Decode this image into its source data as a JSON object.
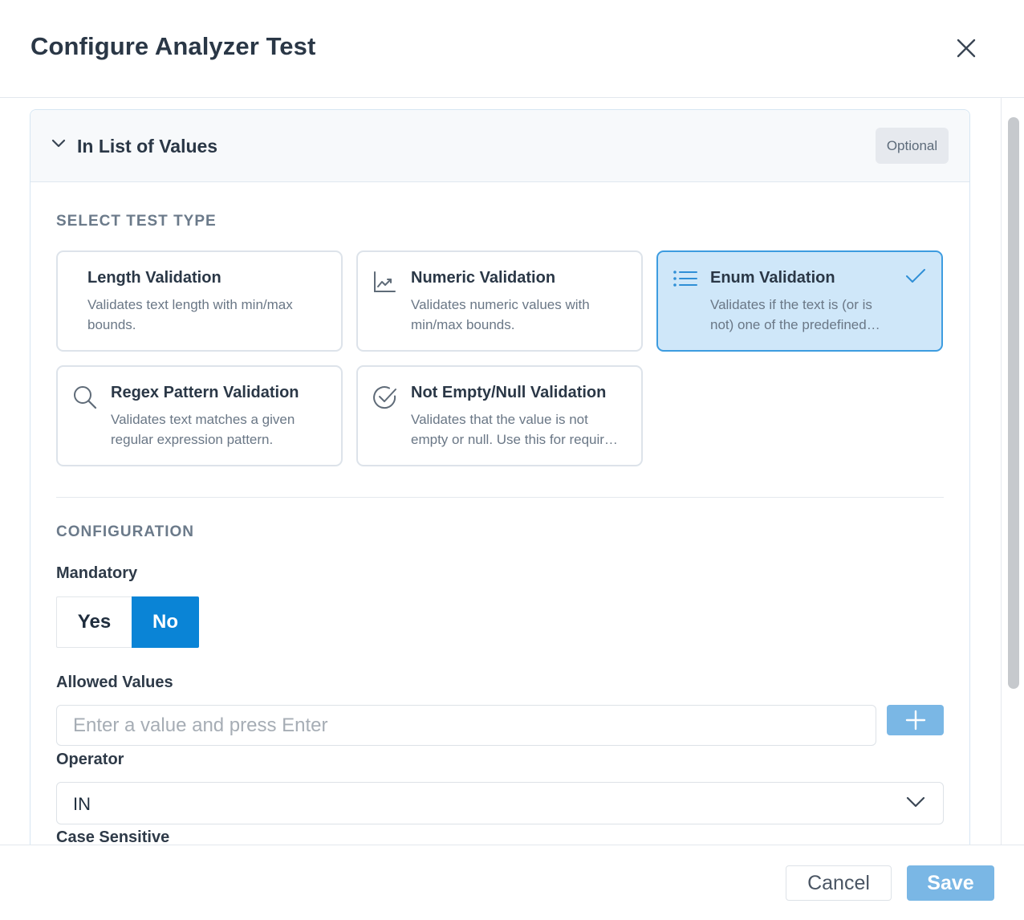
{
  "dialog": {
    "title": "Configure Analyzer Test"
  },
  "section": {
    "title": "In List of Values",
    "badge": "Optional",
    "expanded": true
  },
  "test_type": {
    "heading": "SELECT TEST TYPE",
    "cards": [
      {
        "title": "Length Validation",
        "description": "Validates text length with min/max bounds.",
        "icon": "none",
        "selected": false
      },
      {
        "title": "Numeric Validation",
        "description": "Validates numeric values with min/max bounds.",
        "icon": "chart-line-icon",
        "selected": false
      },
      {
        "title": "Enum Validation",
        "description": "Validates if the text is (or is not) one of the predefined…",
        "icon": "list-icon",
        "selected": true
      },
      {
        "title": "Regex Pattern Validation",
        "description": "Validates text matches a given regular expression pattern.",
        "icon": "search-icon",
        "selected": false
      },
      {
        "title": "Not Empty/Null Validation",
        "description": "Validates that the value is not empty or null. Use this for requir…",
        "icon": "check-circle-icon",
        "selected": false
      }
    ]
  },
  "configuration": {
    "heading": "CONFIGURATION",
    "mandatory": {
      "label": "Mandatory",
      "yes_label": "Yes",
      "no_label": "No",
      "selected": "No"
    },
    "allowed_values": {
      "label": "Allowed Values",
      "value": "",
      "placeholder": "Enter a value and press Enter"
    },
    "operator": {
      "label": "Operator",
      "selected": "IN"
    },
    "case_sensitive": {
      "label": "Case Sensitive"
    }
  },
  "footer": {
    "cancel_label": "Cancel",
    "save_label": "Save"
  },
  "colors": {
    "accent": "#0a84d6",
    "accent_light": "#7ab7e5",
    "selected_card_bg": "#cfe7f9",
    "selected_card_border": "#3d9ce0"
  }
}
